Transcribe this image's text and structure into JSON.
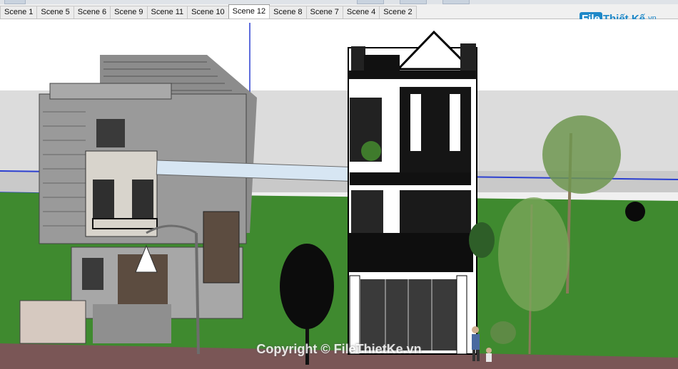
{
  "tabs": {
    "items": [
      {
        "label": "Scene 1"
      },
      {
        "label": "Scene 5"
      },
      {
        "label": "Scene 6"
      },
      {
        "label": "Scene 9"
      },
      {
        "label": "Scene 11"
      },
      {
        "label": "Scene 10"
      },
      {
        "label": "Scene 12"
      },
      {
        "label": "Scene 8"
      },
      {
        "label": "Scene 7"
      },
      {
        "label": "Scene 4"
      },
      {
        "label": "Scene 2"
      }
    ],
    "active": "Scene 12"
  },
  "watermark": {
    "badge": "File",
    "name": "Thiết Kế",
    "tld": ".vn",
    "copyright": "Copyright © FileThietKe.vn"
  },
  "colors": {
    "sky": "#ffffff",
    "horizon": "#dcdcdc",
    "grass": "#3f8a2f",
    "road": "#7a5656",
    "accent": "#1e88c8"
  }
}
